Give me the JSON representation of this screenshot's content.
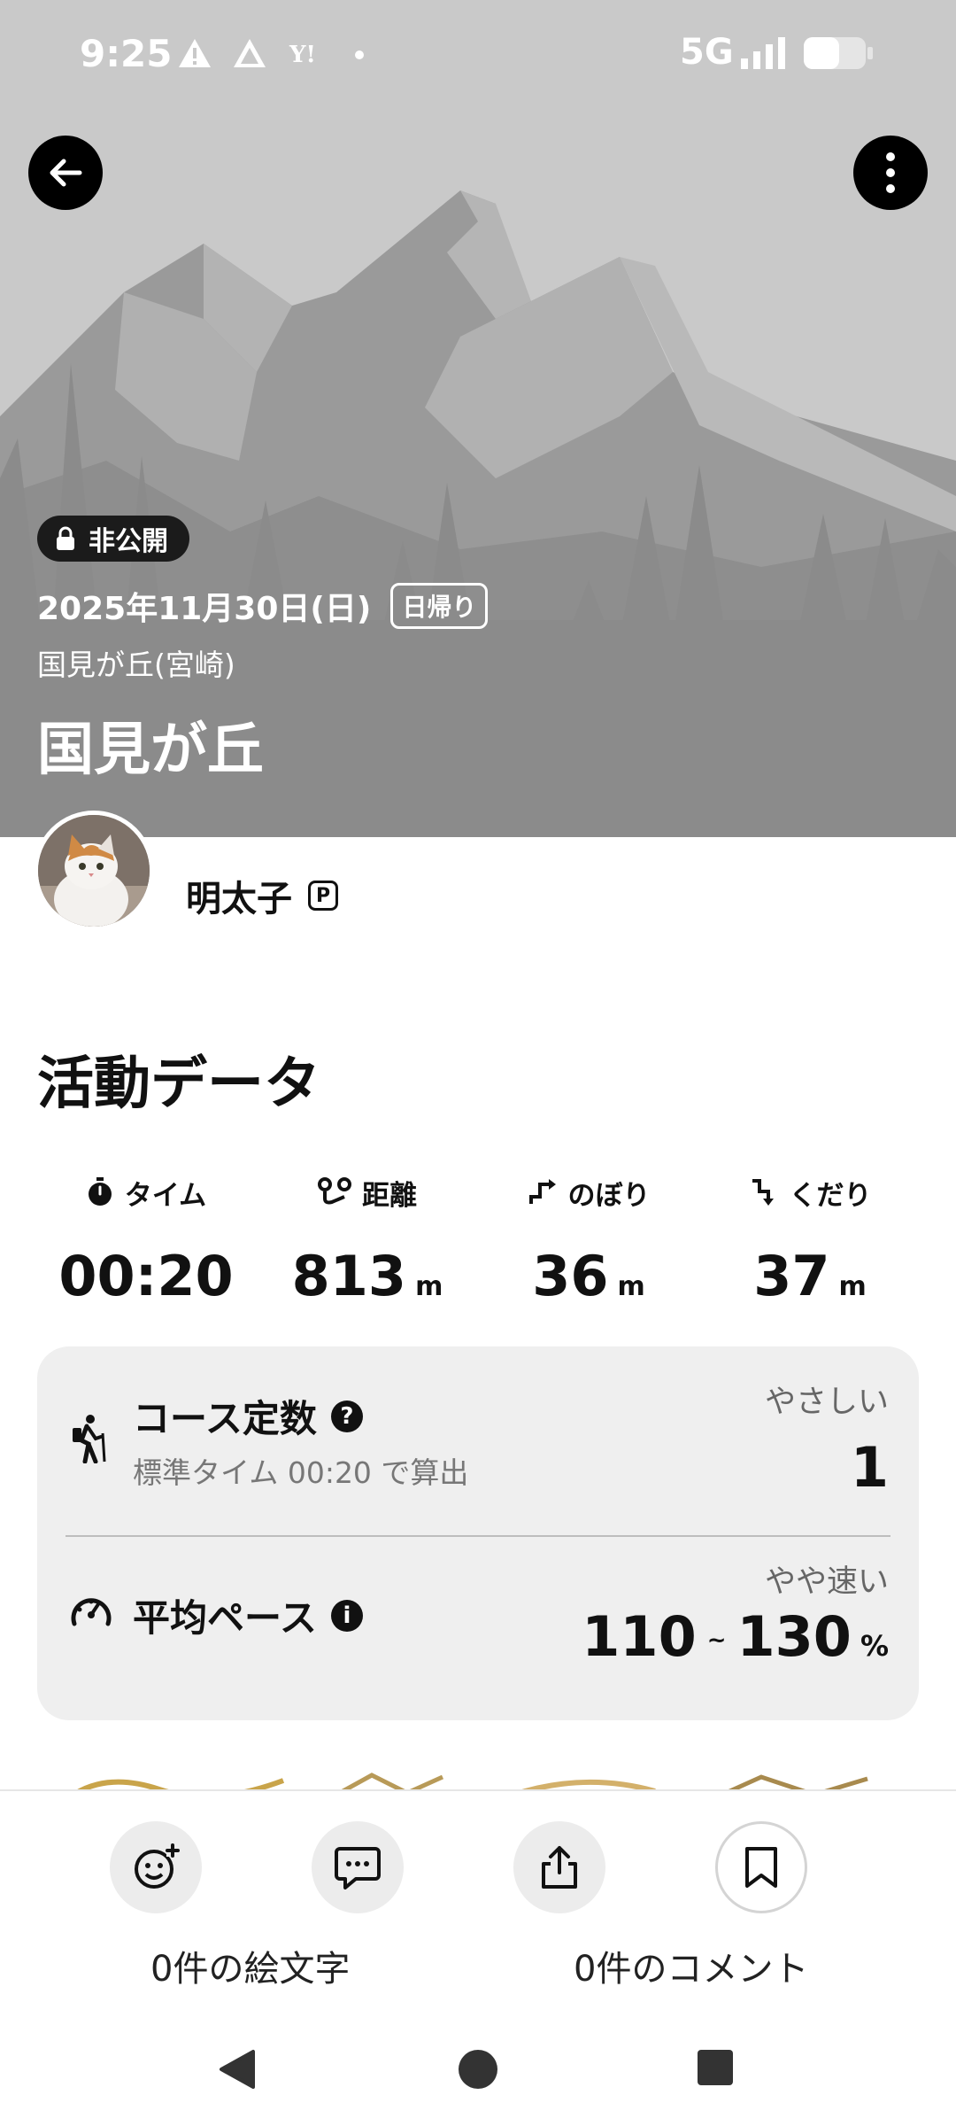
{
  "status_bar": {
    "time": "9:25",
    "network": "5G",
    "icons": [
      "warning-icon",
      "signal-triangle-icon",
      "yahoo-icon",
      "dot-icon",
      "signal-bars-icon",
      "battery-icon"
    ]
  },
  "header": {
    "back_icon": "arrow-left-icon",
    "menu_icon": "more-vertical-icon"
  },
  "hero": {
    "privacy_label": "非公開",
    "date": "2025年11月30日(日)",
    "trip_type": "日帰り",
    "location": "国見が丘(宮崎)",
    "title": "国見が丘"
  },
  "user": {
    "name": "明太子",
    "badge": "P"
  },
  "activity": {
    "section_title": "活動データ",
    "stats": [
      {
        "label": "タイム",
        "value": "00:20",
        "unit": "",
        "icon": "stopwatch-icon"
      },
      {
        "label": "距離",
        "value": "813",
        "unit": "m",
        "icon": "route-icon"
      },
      {
        "label": "のぼり",
        "value": "36",
        "unit": "m",
        "icon": "ascent-icon"
      },
      {
        "label": "くだり",
        "value": "37",
        "unit": "m",
        "icon": "descent-icon"
      }
    ],
    "course_constant": {
      "title": "コース定数",
      "subtitle": "標準タイム 00:20 で算出",
      "level": "やさしい",
      "value": "1"
    },
    "average_pace": {
      "title": "平均ペース",
      "level": "やや速い",
      "value_low": "110",
      "separator": "~",
      "value_high": "130",
      "unit": "%"
    }
  },
  "bottom_bar": {
    "emoji_label": "0件の絵文字",
    "comment_label": "0件のコメント",
    "actions": [
      "add-reaction-icon",
      "comment-icon",
      "share-icon",
      "bookmark-icon"
    ]
  },
  "colors": {
    "hero_bg": "#c9c9c9",
    "card_bg": "#efefef",
    "text": "#111111"
  }
}
